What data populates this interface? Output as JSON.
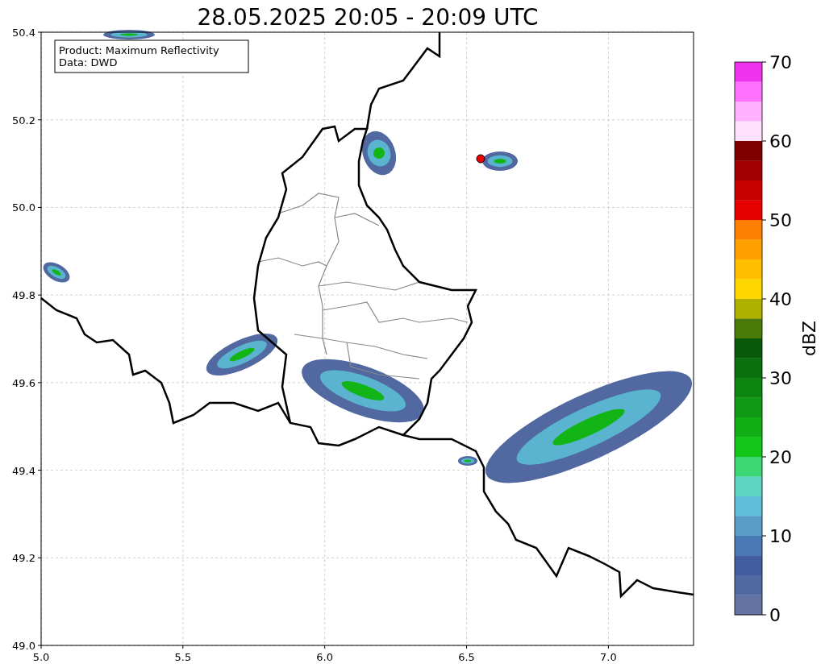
{
  "title": "28.05.2025 20:05 - 20:09 UTC",
  "info_box": {
    "lines": [
      "Product: Maximum Reflectivity",
      "Data: DWD"
    ]
  },
  "map": {
    "x_ticks": [
      "5.0",
      "5.5",
      "6.0",
      "6.5",
      "7.0"
    ],
    "y_ticks": [
      "50.4",
      "50.2",
      "50.0",
      "49.8",
      "49.6",
      "49.4",
      "49.2",
      "49.0"
    ]
  },
  "colorbar": {
    "label": "dBZ",
    "ticks": [
      "70",
      "60",
      "50",
      "40",
      "30",
      "20",
      "10",
      "0"
    ],
    "bins": [
      {
        "color": "#ee33ee"
      },
      {
        "color": "#ff70ff"
      },
      {
        "color": "#ffb0ff"
      },
      {
        "color": "#ffe0ff"
      },
      {
        "color": "#800000"
      },
      {
        "color": "#a00000"
      },
      {
        "color": "#c80000"
      },
      {
        "color": "#e60000"
      },
      {
        "color": "#ff8000"
      },
      {
        "color": "#ff9f00"
      },
      {
        "color": "#ffbf00"
      },
      {
        "color": "#ffd700"
      },
      {
        "color": "#b0b000"
      },
      {
        "color": "#4a7a0a"
      },
      {
        "color": "#0b5a0b"
      },
      {
        "color": "#0a700e"
      },
      {
        "color": "#0d850f"
      },
      {
        "color": "#0e9a12"
      },
      {
        "color": "#10ad14"
      },
      {
        "color": "#12c517"
      },
      {
        "color": "#3cd672"
      },
      {
        "color": "#5ed6c6"
      },
      {
        "color": "#60bcd8"
      },
      {
        "color": "#5a9ec8"
      },
      {
        "color": "#4a7ab5"
      },
      {
        "color": "#435e9f"
      },
      {
        "color": "#5268a0"
      },
      {
        "color": "#6273a3"
      }
    ]
  }
}
